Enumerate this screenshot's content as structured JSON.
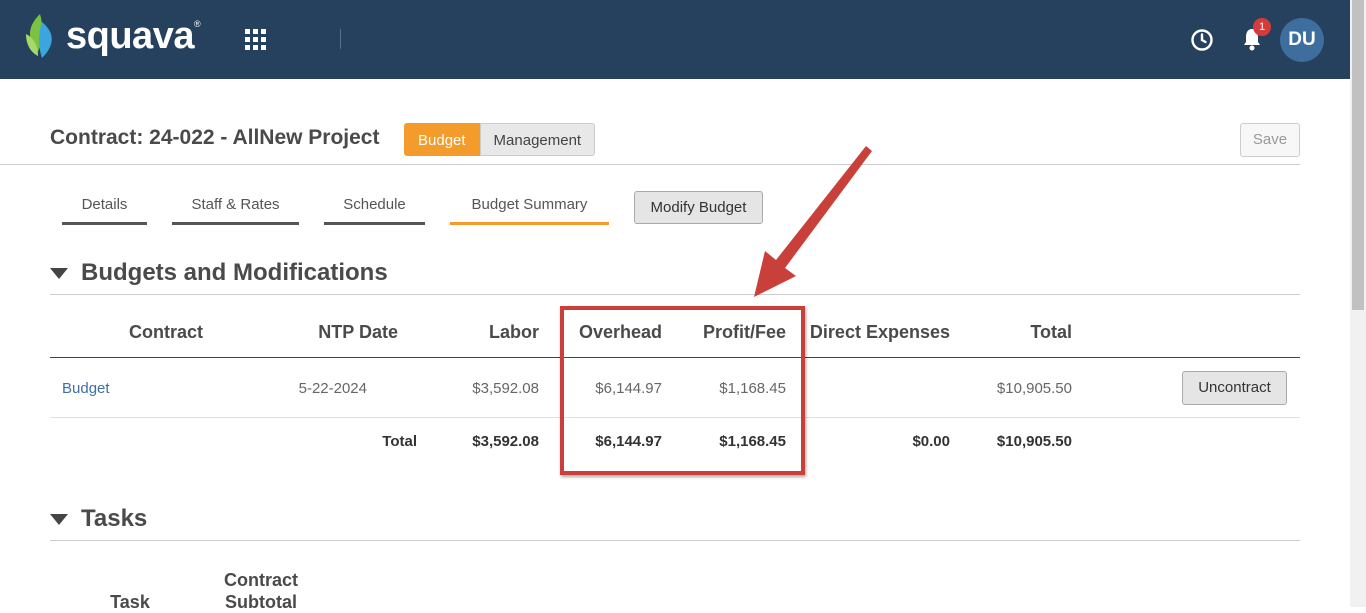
{
  "topbar": {
    "brand": "squava",
    "brand_mark": "®",
    "notification_count": "1",
    "avatar_initials": "DU",
    "colors": {
      "bar": "#26415d",
      "accent": "#f39c2b",
      "badge": "#d63a3a"
    }
  },
  "header": {
    "title": "Contract: 24-022 - AllNew Project",
    "toggle": [
      "Budget",
      "Management"
    ],
    "save_label": "Save"
  },
  "tabs": [
    "Details",
    "Staff & Rates",
    "Schedule",
    "Budget Summary"
  ],
  "active_tab": "Budget Summary",
  "modify_budget_label": "Modify Budget",
  "budgets_section": {
    "title": "Budgets and Modifications",
    "columns": [
      "Contract",
      "NTP Date",
      "Labor",
      "Overhead",
      "Profit/Fee",
      "Direct Expenses",
      "Total"
    ],
    "rows": [
      {
        "contract": "Budget",
        "ntp_date": "5-22-2024",
        "labor": "$3,592.08",
        "overhead": "$6,144.97",
        "profit_fee": "$1,168.45",
        "direct_expenses": "",
        "total": "$10,905.50",
        "action": "Uncontract"
      }
    ],
    "totals": {
      "label": "Total",
      "labor": "$3,592.08",
      "overhead": "$6,144.97",
      "profit_fee": "$1,168.45",
      "direct_expenses": "$0.00",
      "total": "$10,905.50"
    }
  },
  "tasks_section": {
    "title": "Tasks",
    "columns": [
      "Task",
      "Contract\nSubtotal"
    ]
  }
}
